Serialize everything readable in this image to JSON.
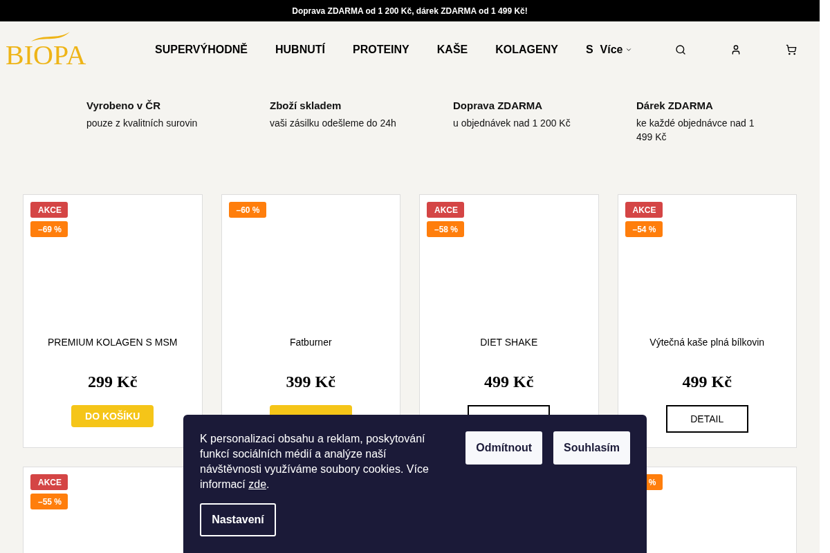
{
  "top_bar": {
    "text": "Doprava ZDARMA od 1 200 Kč, dárek ZDARMA od 1 499 Kč!"
  },
  "header": {
    "logo": "BIOPA",
    "nav": [
      "SUPERVÝHODNĚ",
      "HUBNUTÍ",
      "PROTEINY",
      "KAŠE",
      "KOLAGENY",
      "S"
    ],
    "more": "Více"
  },
  "features": [
    {
      "title": "Vyrobeno v ČR",
      "text": "pouze z kvalitních surovin"
    },
    {
      "title": "Zboží skladem",
      "text": "vaši zásilku odešleme do 24h"
    },
    {
      "title": "Doprava ZDARMA",
      "text": "u objednávek nad 1 200 Kč"
    },
    {
      "title": "Dárek ZDARMA",
      "text": "ke každé objednávce nad 1 499 Kč"
    }
  ],
  "products": [
    {
      "badges": [
        {
          "kind": "sale",
          "text": "AKCE"
        },
        {
          "kind": "discount",
          "text": "–69 %"
        }
      ],
      "name": "PREMIUM KOLAGEN S MSM",
      "price": "299 Kč",
      "button": {
        "kind": "cart",
        "label": "DO KOŠÍKU"
      }
    },
    {
      "badges": [
        {
          "kind": "discount",
          "text": "–60 %"
        }
      ],
      "name": "Fatburner",
      "price": "399 Kč",
      "button": {
        "kind": "cart"
      }
    },
    {
      "badges": [
        {
          "kind": "sale",
          "text": "AKCE"
        },
        {
          "kind": "discount",
          "text": "–58 %"
        }
      ],
      "name": "DIET SHAKE",
      "price": "499 Kč",
      "button": {
        "kind": "detail"
      }
    },
    {
      "badges": [
        {
          "kind": "sale",
          "text": "AKCE"
        },
        {
          "kind": "discount",
          "text": "–54 %"
        }
      ],
      "name": "Výtečná kaše plná bílkovin",
      "price": "499 Kč",
      "button": {
        "kind": "detail",
        "label": "DETAIL"
      }
    },
    {
      "badges": [
        {
          "kind": "sale",
          "text": "AKCE"
        },
        {
          "kind": "discount",
          "text": "–55 %"
        }
      ]
    },
    {
      "badges": [
        {
          "kind": "discount",
          "text": "%"
        }
      ]
    }
  ],
  "cookie_banner": {
    "text": "K personalizaci obsahu a reklam, poskytování funkcí sociálních médií a analýze naší návštěvnosti využíváme soubory cookies. Více informací ",
    "link": "zde",
    "after": ".",
    "buttons": [
      "Odmítnout",
      "Souhlasím"
    ],
    "settings": "Nastavení"
  }
}
